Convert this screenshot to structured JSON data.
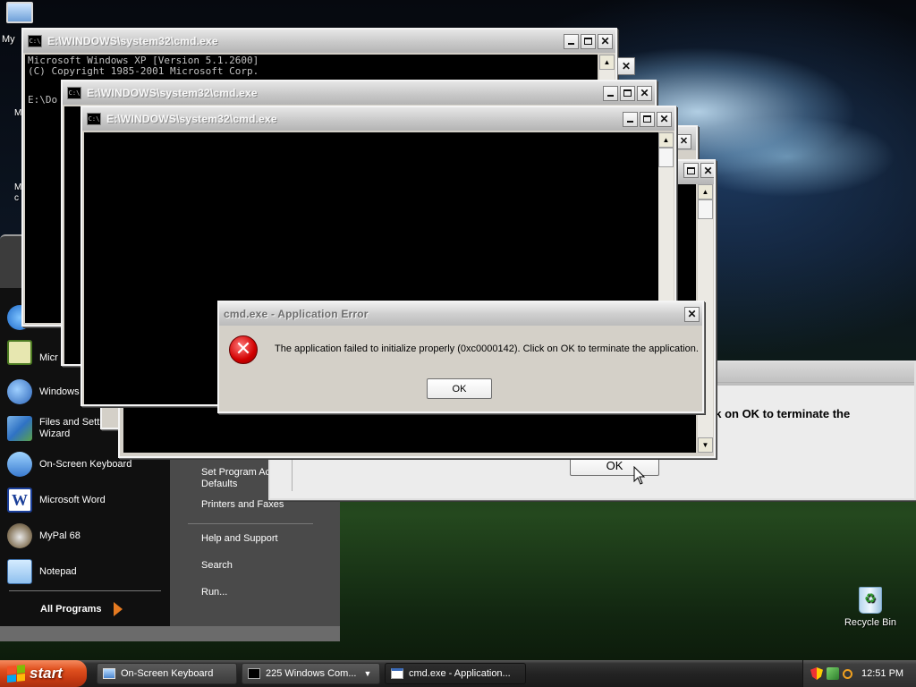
{
  "desktop": {
    "my_computer_label": "My",
    "recycle_bin_label": "Recycle Bin",
    "edge_fragments": [
      "M",
      "M",
      "c"
    ]
  },
  "cmd_windows": [
    {
      "title": "E:\\WINDOWS\\system32\\cmd.exe",
      "lines": [
        "Microsoft Windows XP [Version 5.1.2600]",
        "(C) Copyright 1985-2001 Microsoft Corp.",
        "",
        "E:\\Do"
      ]
    },
    {
      "title": "E:\\WINDOWS\\system32\\cmd.exe"
    },
    {
      "title": "E:\\WINDOWS\\system32\\cmd.exe"
    }
  ],
  "cmd_icon_text": "C:\\",
  "background_error": {
    "message_fragment": "ck on OK to terminate the",
    "ok_label": "OK"
  },
  "error_dialog": {
    "title": "cmd.exe - Application Error",
    "message": "The application failed to initialize properly (0xc0000142). Click on OK to terminate the application.",
    "ok_label": "OK",
    "icon": "error-icon"
  },
  "start_menu": {
    "left_items": [
      {
        "label": "",
        "icon": "internet-explorer-icon"
      },
      {
        "label": "Micr",
        "icon": "outlook-icon"
      },
      {
        "label": "Windows",
        "icon": "media-player-icon"
      },
      {
        "label": "Files and Settings Transfer Wizard",
        "line1": "Files and Setti",
        "line2": "Wizard",
        "icon": "transfer-wizard-icon"
      },
      {
        "label": "On-Screen Keyboard",
        "icon": "keyboard-icon"
      },
      {
        "label": "Microsoft Word",
        "icon": "word-icon"
      },
      {
        "label": "MyPal 68",
        "icon": "mypal-icon"
      },
      {
        "label": "Notepad",
        "icon": "notepad-icon"
      }
    ],
    "all_programs": "All Programs",
    "right_items": {
      "set_program_line1": "Set Program Ac",
      "set_program_line2": "Defaults",
      "printers": "Printers and Faxes",
      "help": "Help and Support",
      "search": "Search",
      "run": "Run..."
    }
  },
  "taskbar": {
    "start_label": "start",
    "tasks": [
      {
        "label": "On-Screen Keyboard"
      },
      {
        "label": "225 Windows Com..."
      },
      {
        "label": "cmd.exe - Application..."
      }
    ],
    "clock": "12:51 PM"
  },
  "colors": {
    "start_button": "#d9491a",
    "error_icon": "#d10000",
    "all_programs_arrow": "#e57a21",
    "console_bg": "#000000"
  }
}
